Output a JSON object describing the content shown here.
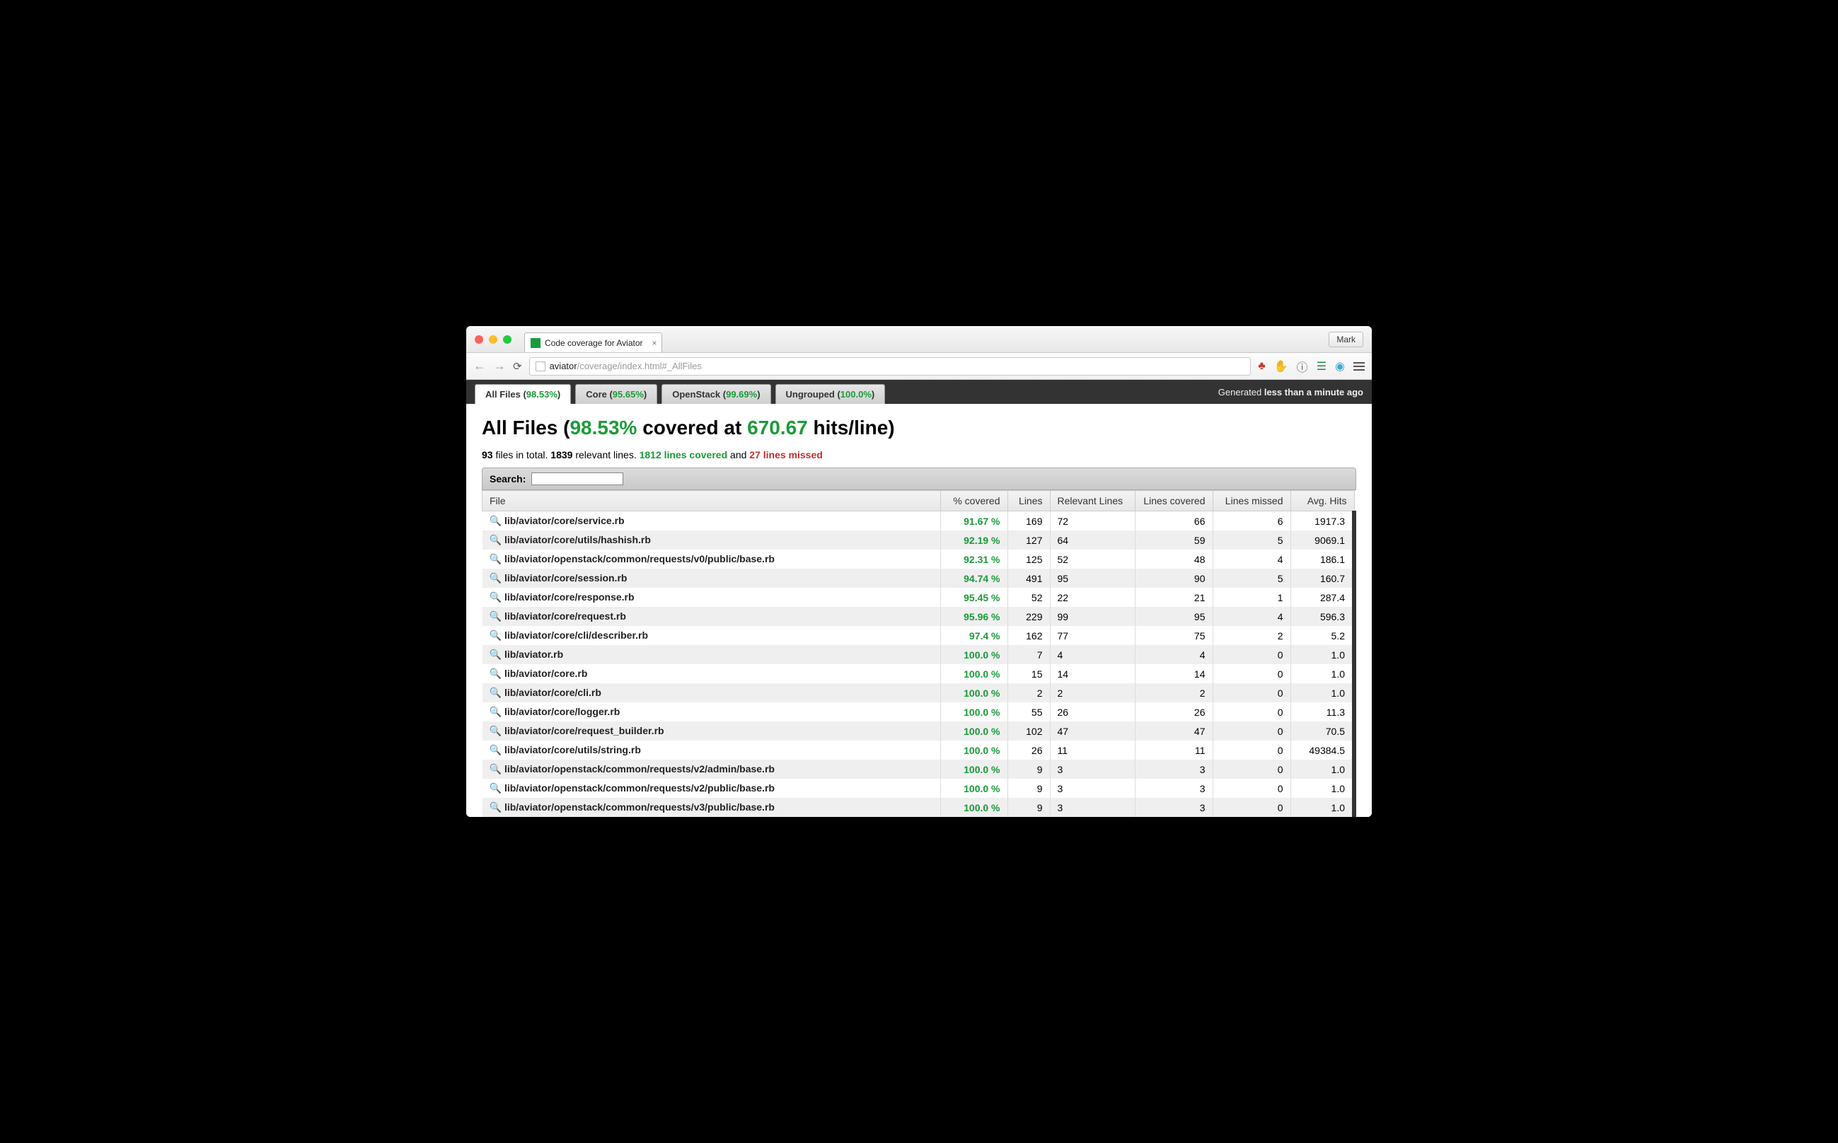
{
  "browser": {
    "tab_title": "Code coverage for Aviator",
    "user_button": "Mark",
    "url_host": "aviator",
    "url_path": "/coverage/index.html#_AllFiles"
  },
  "tabs": [
    {
      "label": "All Files",
      "pct": "98.53%",
      "active": true
    },
    {
      "label": "Core",
      "pct": "95.65%",
      "active": false
    },
    {
      "label": "OpenStack",
      "pct": "99.69%",
      "active": false
    },
    {
      "label": "Ungrouped",
      "pct": "100.0%",
      "active": false
    }
  ],
  "generated_prefix": "Generated ",
  "generated_time": "less than a minute ago",
  "heading": {
    "title": "All Files",
    "pct": "98.53%",
    "mid": " covered at ",
    "hits": "670.67",
    "suffix": " hits/line)"
  },
  "summary": {
    "file_count": "93",
    "files_text": " files in total. ",
    "relevant": "1839",
    "relevant_text": " relevant lines. ",
    "covered": "1812 lines covered",
    "and": " and ",
    "missed": "27 lines missed"
  },
  "search_label": "Search:",
  "columns": {
    "file": "File",
    "pct": "% covered",
    "lines": "Lines",
    "relevant": "Relevant Lines",
    "covered": "Lines covered",
    "missed": "Lines missed",
    "avg": "Avg. Hits"
  },
  "rows": [
    {
      "file": "lib/aviator/core/service.rb",
      "pct": "91.67 %",
      "lines": "169",
      "rel": "72",
      "cov": "66",
      "miss": "6",
      "avg": "1917.3"
    },
    {
      "file": "lib/aviator/core/utils/hashish.rb",
      "pct": "92.19 %",
      "lines": "127",
      "rel": "64",
      "cov": "59",
      "miss": "5",
      "avg": "9069.1"
    },
    {
      "file": "lib/aviator/openstack/common/requests/v0/public/base.rb",
      "pct": "92.31 %",
      "lines": "125",
      "rel": "52",
      "cov": "48",
      "miss": "4",
      "avg": "186.1"
    },
    {
      "file": "lib/aviator/core/session.rb",
      "pct": "94.74 %",
      "lines": "491",
      "rel": "95",
      "cov": "90",
      "miss": "5",
      "avg": "160.7"
    },
    {
      "file": "lib/aviator/core/response.rb",
      "pct": "95.45 %",
      "lines": "52",
      "rel": "22",
      "cov": "21",
      "miss": "1",
      "avg": "287.4"
    },
    {
      "file": "lib/aviator/core/request.rb",
      "pct": "95.96 %",
      "lines": "229",
      "rel": "99",
      "cov": "95",
      "miss": "4",
      "avg": "596.3"
    },
    {
      "file": "lib/aviator/core/cli/describer.rb",
      "pct": "97.4 %",
      "lines": "162",
      "rel": "77",
      "cov": "75",
      "miss": "2",
      "avg": "5.2"
    },
    {
      "file": "lib/aviator.rb",
      "pct": "100.0 %",
      "lines": "7",
      "rel": "4",
      "cov": "4",
      "miss": "0",
      "avg": "1.0"
    },
    {
      "file": "lib/aviator/core.rb",
      "pct": "100.0 %",
      "lines": "15",
      "rel": "14",
      "cov": "14",
      "miss": "0",
      "avg": "1.0"
    },
    {
      "file": "lib/aviator/core/cli.rb",
      "pct": "100.0 %",
      "lines": "2",
      "rel": "2",
      "cov": "2",
      "miss": "0",
      "avg": "1.0"
    },
    {
      "file": "lib/aviator/core/logger.rb",
      "pct": "100.0 %",
      "lines": "55",
      "rel": "26",
      "cov": "26",
      "miss": "0",
      "avg": "11.3"
    },
    {
      "file": "lib/aviator/core/request_builder.rb",
      "pct": "100.0 %",
      "lines": "102",
      "rel": "47",
      "cov": "47",
      "miss": "0",
      "avg": "70.5"
    },
    {
      "file": "lib/aviator/core/utils/string.rb",
      "pct": "100.0 %",
      "lines": "26",
      "rel": "11",
      "cov": "11",
      "miss": "0",
      "avg": "49384.5"
    },
    {
      "file": "lib/aviator/openstack/common/requests/v2/admin/base.rb",
      "pct": "100.0 %",
      "lines": "9",
      "rel": "3",
      "cov": "3",
      "miss": "0",
      "avg": "1.0"
    },
    {
      "file": "lib/aviator/openstack/common/requests/v2/public/base.rb",
      "pct": "100.0 %",
      "lines": "9",
      "rel": "3",
      "cov": "3",
      "miss": "0",
      "avg": "1.0"
    },
    {
      "file": "lib/aviator/openstack/common/requests/v3/public/base.rb",
      "pct": "100.0 %",
      "lines": "9",
      "rel": "3",
      "cov": "3",
      "miss": "0",
      "avg": "1.0"
    }
  ]
}
